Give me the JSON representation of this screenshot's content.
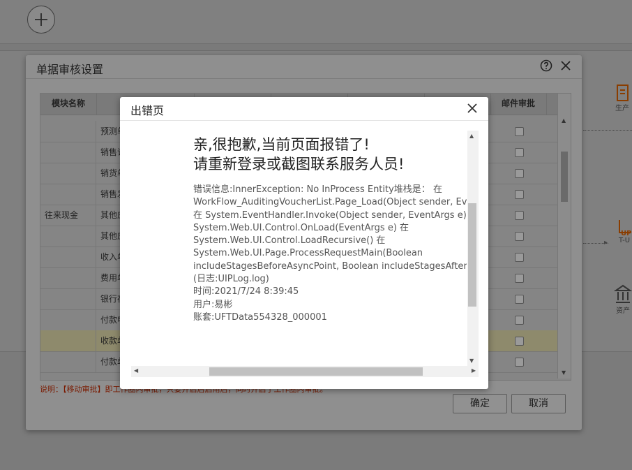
{
  "background": {
    "flow_nodes": [
      {
        "label": "生产"
      },
      {
        "label": "T-U"
      },
      {
        "label": "资产"
      }
    ]
  },
  "audit_dialog": {
    "title": "单据审核设置",
    "columns": {
      "module": "模块名称",
      "mail_approval": "邮件审批"
    },
    "rows": [
      {
        "module": "",
        "name": "预测单",
        "highlighted": false
      },
      {
        "module": "",
        "name": "销售订单",
        "highlighted": false
      },
      {
        "module": "",
        "name": "销货单",
        "highlighted": false
      },
      {
        "module": "",
        "name": "销售发票",
        "highlighted": false
      },
      {
        "module": "往来现金",
        "name": "其他应收单",
        "highlighted": false
      },
      {
        "module": "",
        "name": "其他应付单",
        "highlighted": false
      },
      {
        "module": "",
        "name": "收入单",
        "highlighted": false
      },
      {
        "module": "",
        "name": "费用单",
        "highlighted": false
      },
      {
        "module": "",
        "name": "银行存取款单",
        "highlighted": false
      },
      {
        "module": "",
        "name": "付款申请单",
        "highlighted": false
      },
      {
        "module": "",
        "name": "收款单",
        "highlighted": true
      },
      {
        "module": "",
        "name": "付款单",
        "highlighted": false
      }
    ],
    "note": "说明：【移动审批】即工作圈内审批，只要开启后启用后，同时开启于工作圈内审批。",
    "confirm_label": "确定",
    "cancel_label": "取消"
  },
  "error_dialog": {
    "title": "出错页",
    "headline_1": "亲,很抱歉,当前页面报错了!",
    "headline_2": "请重新登录或截图联系服务人员!",
    "detail_lines": [
      "错误信息:InnerException: No InProcess Entity堆栈是：  在",
      "WorkFlow_AuditingVoucherList.Page_Load(Object sender, EventArgs e)",
      "在 System.EventHandler.Invoke(Object sender, EventArgs e) 在",
      "System.Web.UI.Control.OnLoad(EventArgs e) 在",
      "System.Web.UI.Control.LoadRecursive() 在",
      "System.Web.UI.Page.ProcessRequestMain(Boolean",
      "includeStagesBeforeAsyncPoint, Boolean includeStagesAfterAsyncPoint)",
      "(日志:UIPLog.log)"
    ],
    "time": "时间:2021/7/24 8:39:45",
    "user": "用户:易彬",
    "account": "账套:UFTData554328_000001"
  }
}
